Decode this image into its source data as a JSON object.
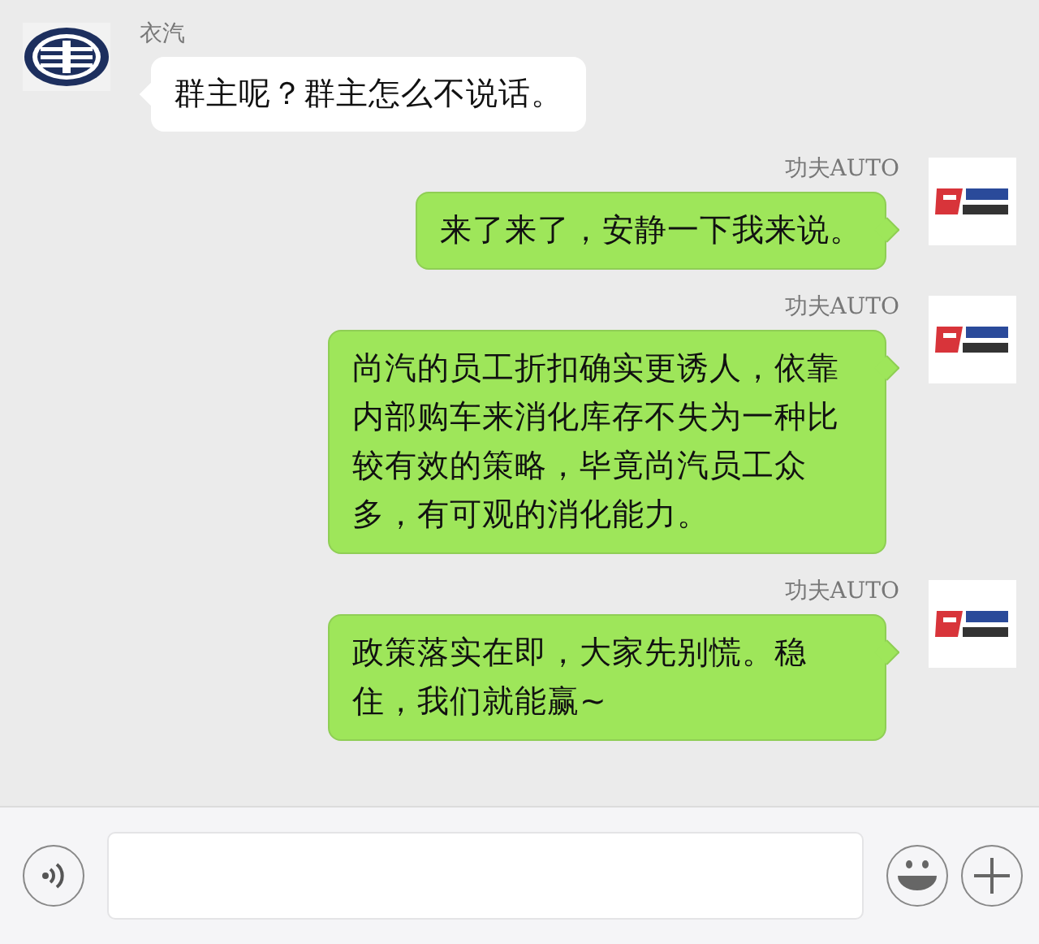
{
  "messages": [
    {
      "kind": "incoming",
      "sender": "衣汽",
      "text": "群主呢？群主怎么不说话。"
    },
    {
      "kind": "outgoing",
      "sender": "功夫AUTO",
      "text": "来了来了，安静一下我来说。"
    },
    {
      "kind": "outgoing",
      "sender": "功夫AUTO",
      "text": "尚汽的员工折扣确实更诱人，依靠内部购车来消化库存不失为一种比较有效的策略，毕竟尚汽员工众多，有可观的消化能力。"
    },
    {
      "kind": "outgoing",
      "sender": "功夫AUTO",
      "text": "政策落实在即，大家先别慌。稳住，我们就能赢~"
    }
  ]
}
